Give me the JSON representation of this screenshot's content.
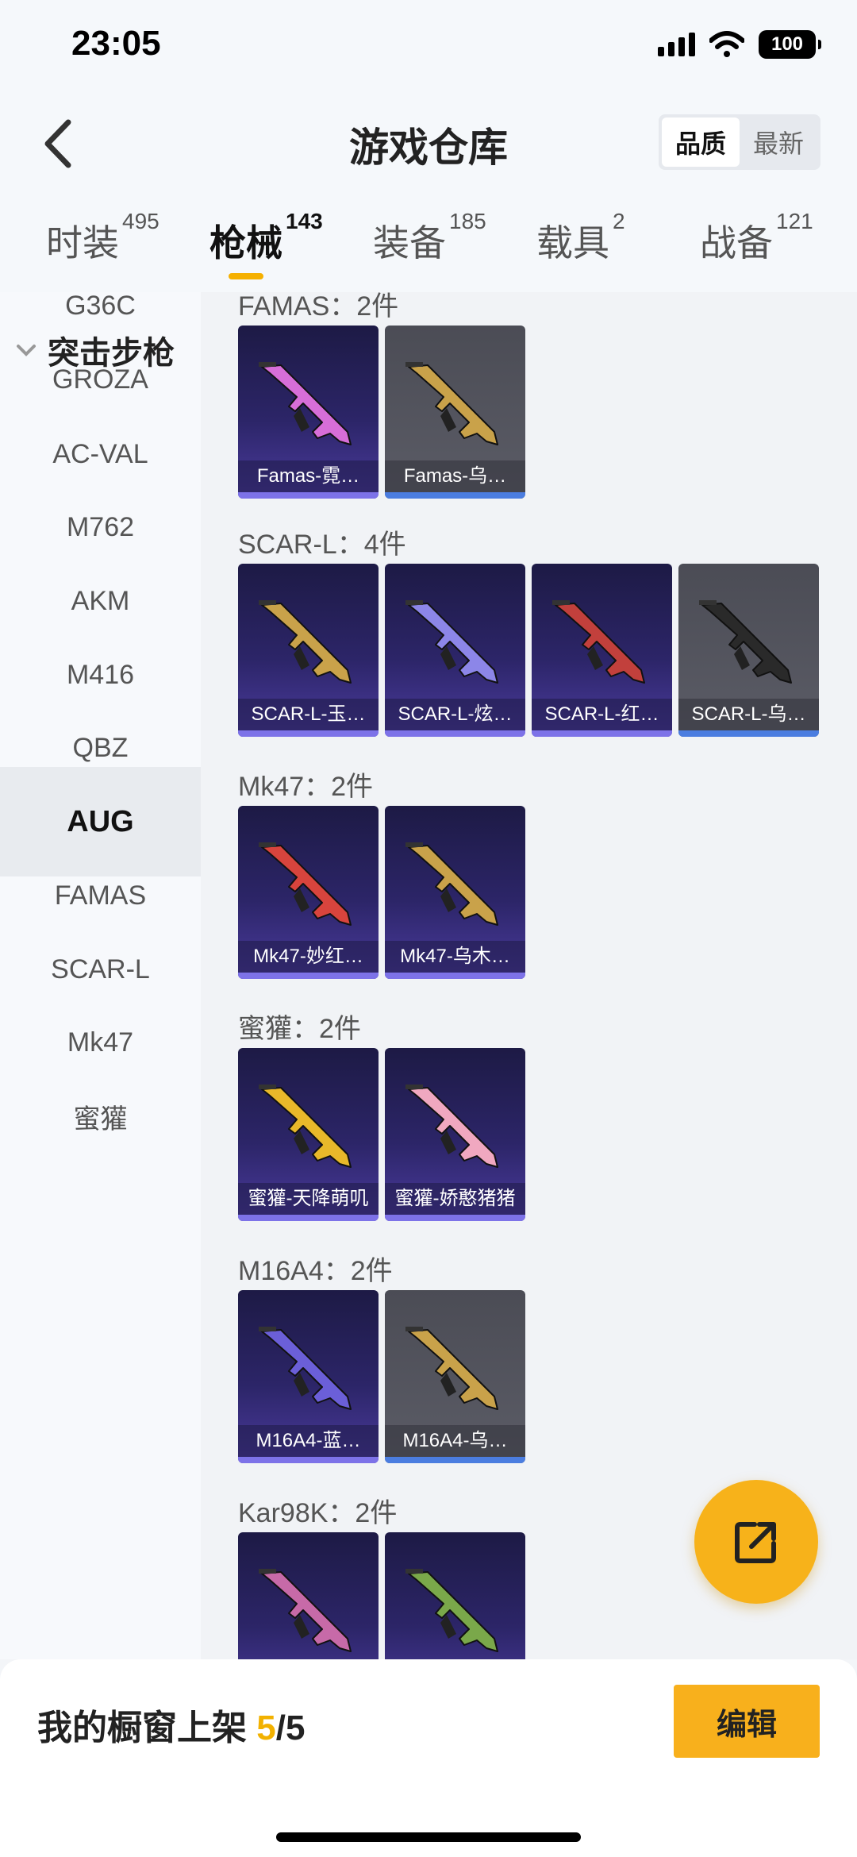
{
  "status": {
    "time": "23:05",
    "battery": "100"
  },
  "header": {
    "title": "游戏仓库",
    "sort_options": [
      "品质",
      "最新"
    ]
  },
  "tabs": [
    {
      "label": "时装",
      "count": "495"
    },
    {
      "label": "枪械",
      "count": "143"
    },
    {
      "label": "装备",
      "count": "185"
    },
    {
      "label": "载具",
      "count": "2"
    },
    {
      "label": "战备",
      "count": "121"
    }
  ],
  "sidebar": {
    "category": "突击步枪",
    "items": [
      "G36C",
      "GROZA",
      "AC-VAL",
      "M762",
      "AKM",
      "M416",
      "QBZ",
      "AUG",
      "FAMAS",
      "SCAR-L",
      "Mk47",
      "蜜獾"
    ]
  },
  "groups": [
    {
      "title": "FAMAS：2件",
      "items": [
        {
          "label": "Famas-霓…",
          "style": "purple",
          "color": "#d76ed8"
        },
        {
          "label": "Famas-乌…",
          "style": "grey",
          "color": "#c9a24a"
        }
      ]
    },
    {
      "title": "SCAR-L：4件",
      "items": [
        {
          "label": "SCAR-L-玉…",
          "style": "purple",
          "color": "#c9a24a"
        },
        {
          "label": "SCAR-L-炫…",
          "style": "purple",
          "color": "#8c86e8"
        },
        {
          "label": "SCAR-L-红…",
          "style": "purple",
          "color": "#c2403c"
        },
        {
          "label": "SCAR-L-乌…",
          "style": "grey",
          "color": "#2a2a2a"
        }
      ]
    },
    {
      "title": "Mk47：2件",
      "items": [
        {
          "label": "Mk47-妙红…",
          "style": "purple",
          "color": "#d8443d"
        },
        {
          "label": "Mk47-乌木…",
          "style": "purple",
          "color": "#c9a24a"
        }
      ]
    },
    {
      "title": "蜜獾：2件",
      "items": [
        {
          "label": "蜜獾-天降萌叽",
          "style": "purple",
          "color": "#e8b82a"
        },
        {
          "label": "蜜獾-娇憨猪猪",
          "style": "purple",
          "color": "#f0a8c0"
        }
      ]
    },
    {
      "title": "M16A4：2件",
      "items": [
        {
          "label": "M16A4-蓝…",
          "style": "purple",
          "color": "#6b5fd8"
        },
        {
          "label": "M16A4-乌…",
          "style": "grey",
          "color": "#c9a24a"
        }
      ]
    },
    {
      "title": "Kar98K：2件",
      "items": [
        {
          "label": "",
          "style": "purple",
          "color": "#c76aa8"
        },
        {
          "label": "",
          "style": "purple",
          "color": "#7aa84a"
        }
      ]
    }
  ],
  "bottom": {
    "showcase_label": "我的橱窗上架",
    "used": "5",
    "total": "/5",
    "edit_label": "编辑"
  },
  "colors": {
    "accent": "#f8b01c",
    "card_purple": "#2c2568",
    "card_grey": "#55565f"
  }
}
